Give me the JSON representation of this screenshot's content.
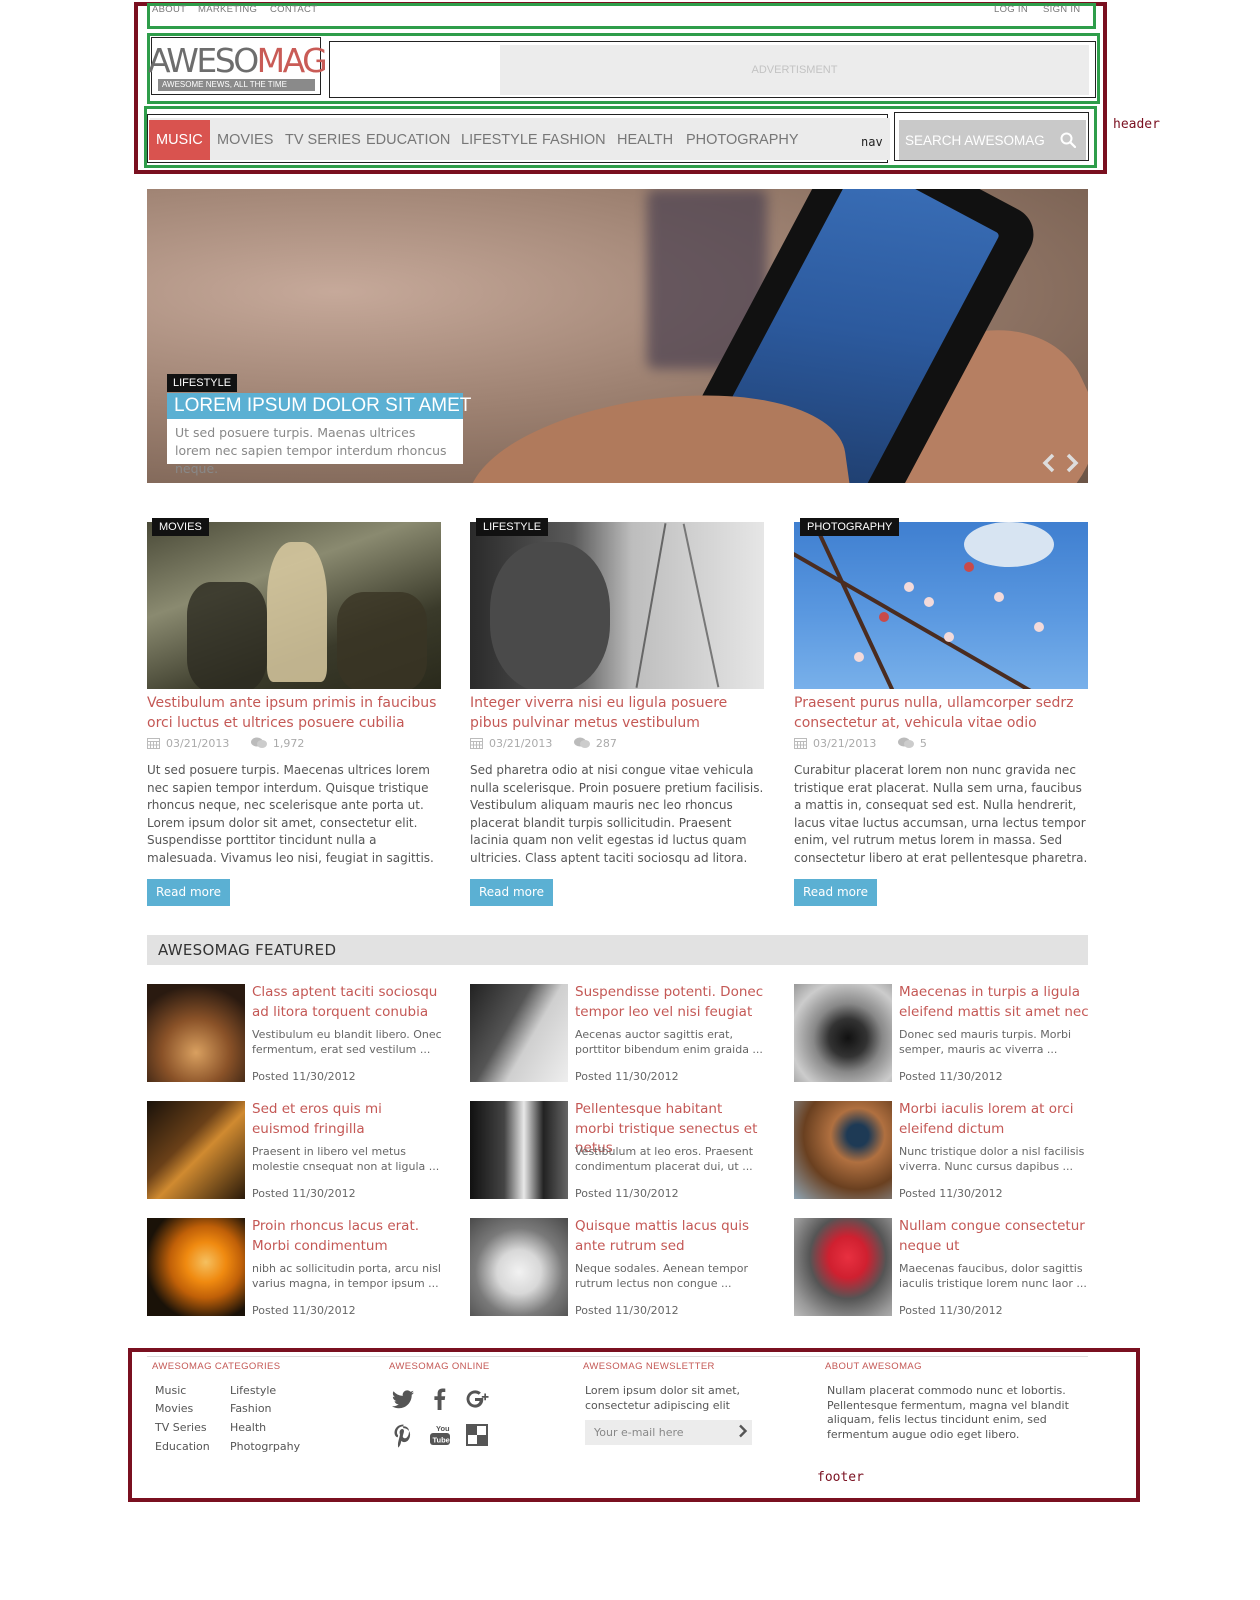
{
  "annotations": {
    "header": "header",
    "nav": "nav",
    "footer": "footer"
  },
  "topbar": {
    "left_links": [
      "ABOUT",
      "MARKETING",
      "CONTACT"
    ],
    "right_links": [
      "LOG IN",
      "SIGN IN"
    ]
  },
  "logo": {
    "part1": "AWESO",
    "part2": "MAG",
    "tagline": "AWESOME NEWS, ALL THE TIME"
  },
  "ad": {
    "label": "ADVERTISMENT"
  },
  "nav": {
    "items": [
      "MUSIC",
      "MOVIES",
      "TV SERIES",
      "EDUCATION",
      "LIFESTYLE",
      "FASHION",
      "HEALTH",
      "PHOTOGRAPHY"
    ],
    "active_index": 0
  },
  "search": {
    "placeholder": "SEARCH AWESOMAG",
    "icon": "search-icon"
  },
  "hero": {
    "category": "LIFESTYLE",
    "title": "LOREM IPSUM DOLOR SIT AMET",
    "excerpt": "Ut sed posuere turpis. Maenas ultrices lorem nec sapien tempor interdum rhoncus neque."
  },
  "articles": [
    {
      "category": "MOVIES",
      "title": "Vestibulum ante ipsum primis in faucibus orci luctus et ultrices posuere cubilia",
      "date": "03/21/2013",
      "comments": "1,972",
      "body": "Ut sed posuere turpis. Maecenas ultrices lorem nec sapien tempor interdum. Quisque tristique rhoncus neque, nec scelerisque ante porta ut. Lorem ipsum dolor sit amet, consectetur  elit. Suspendisse porttitor tincidunt nulla a malesuada. Vivamus leo nisi, feugiat in sagittis.",
      "button": "Read more"
    },
    {
      "category": "LIFESTYLE",
      "title": "Integer viverra nisi eu ligula posuere pibus pulvinar metus vestibulum",
      "date": "03/21/2013",
      "comments": "287",
      "body": "Sed pharetra odio at nisi congue vitae vehicula nulla scelerisque. Proin posuere pretium facilisis. Vestibulum aliquam mauris nec leo rhoncus placerat blandit turpis sollicitudin. Praesent lacinia quam non velit egestas id luctus quam ultricies. Class aptent taciti sociosqu ad litora.",
      "button": "Read more"
    },
    {
      "category": "PHOTOGRAPHY",
      "title": "Praesent purus nulla, ullamcorper sedrz consectetur at, vehicula vitae odio",
      "date": "03/21/2013",
      "comments": "5",
      "body": "Curabitur placerat lorem non nunc gravida nec tristique erat placerat. Nulla sem urna, faucibus a mattis in, consequat sed est. Nulla hendrerit, lacus vitae luctus accumsan, urna lectus tempor enim, vel rutrum metus lorem in massa. Sed consectetur libero at erat pellentesque pharetra.",
      "button": "Read more"
    }
  ],
  "featured": {
    "heading": "AWESOMAG FEATURED",
    "items": [
      {
        "title": "Class aptent taciti sociosqu ad litora torquent conubia",
        "excerpt": "Vestibulum eu blandit libero. Onec fermentum, erat sed vestilum ...",
        "date": "Posted 11/30/2012"
      },
      {
        "title": "Suspendisse potenti. Donec tempor leo vel nisi feugiat",
        "excerpt": "Aecenas auctor sagittis erat, porttitor bibendum enim graida ...",
        "date": "Posted 11/30/2012"
      },
      {
        "title": "Maecenas in turpis a ligula eleifend mattis sit amet nec",
        "excerpt": "Donec sed mauris turpis. Morbi semper, mauris ac viverra ...",
        "date": "Posted 11/30/2012"
      },
      {
        "title": "Sed et eros quis mi euismod fringilla",
        "excerpt": "Praesent in libero vel metus molestie cnsequat non at ligula ...",
        "date": "Posted 11/30/2012"
      },
      {
        "title": "Pellentesque habitant morbi tristique senectus et netus",
        "excerpt": "Vestibulum at leo eros. Praesent condimentum placerat dui, ut ...",
        "date": "Posted 11/30/2012"
      },
      {
        "title": "Morbi iaculis lorem at orci eleifend dictum",
        "excerpt": "Nunc tristique dolor a nisl facilisis viverra. Nunc cursus dapibus ...",
        "date": "Posted 11/30/2012"
      },
      {
        "title": "Proin rhoncus lacus erat. Morbi condimentum",
        "excerpt": "nibh ac sollicitudin porta, arcu nisl varius magna, in tempor ipsum ...",
        "date": "Posted 11/30/2012"
      },
      {
        "title": "Quisque mattis lacus quis ante rutrum sed",
        "excerpt": "Neque sodales. Aenean tempor rutrum lectus non congue ...",
        "date": "Posted 11/30/2012"
      },
      {
        "title": "Nullam congue consectetur neque ut",
        "excerpt": "Maecenas faucibus, dolor sagittis iaculis tristique lorem nunc laor ...",
        "date": "Posted 11/30/2012"
      }
    ]
  },
  "footer": {
    "categories": {
      "heading": "AWESOMAG CATEGORIES",
      "col1": [
        "Music",
        "Movies",
        "TV Series",
        "Education"
      ],
      "col2": [
        "Lifestyle",
        "Fashion",
        "Health",
        "Photogrpahy"
      ]
    },
    "online": {
      "heading": "AWESOMAG ONLINE",
      "icons": [
        "twitter-icon",
        "facebook-icon",
        "google-plus-icon",
        "pinterest-icon",
        "youtube-icon",
        "delicious-icon"
      ]
    },
    "newsletter": {
      "heading": "AWESOMAG NEWSLETTER",
      "text": "Lorem ipsum dolor sit amet, consectetur adipiscing elit",
      "placeholder": "Your e-mail here"
    },
    "about": {
      "heading": "ABOUT AWESOMAG",
      "text": "Nullam placerat commodo nunc et lobortis. Pellentesque fermentum, magna vel blandit aliquam, felis lectus tincidunt enim, sed fermentum augue odio eget libero."
    }
  },
  "colors": {
    "accent": "#d9534f",
    "link": "#c45855",
    "button": "#5bb0d3",
    "header_frame": "#7a1020",
    "section_frame": "#2e9d4a"
  }
}
